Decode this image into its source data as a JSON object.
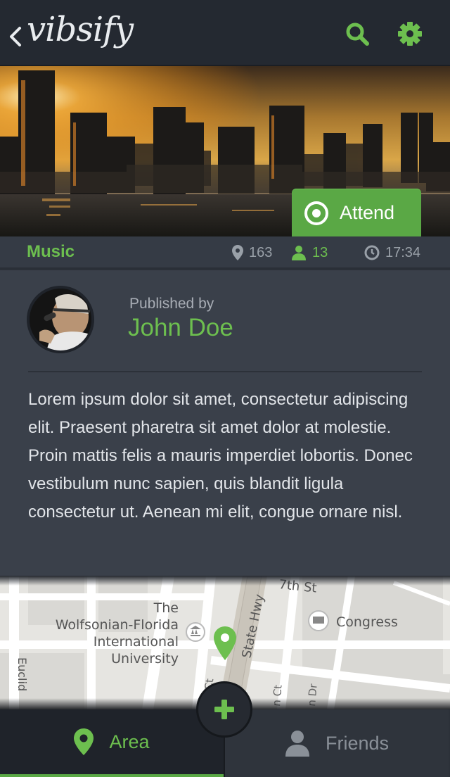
{
  "header": {
    "app_name": "vibsify",
    "icons": {
      "back": "chevron-left-icon",
      "search": "search-icon",
      "settings": "gear-icon"
    }
  },
  "event": {
    "attend_label": "Attend",
    "category": "Music",
    "distance": "163",
    "attendees": "13",
    "time": "17:34"
  },
  "publisher": {
    "label": "Published by",
    "name": "John Doe"
  },
  "description": "Lorem ipsum dolor sit amet, consectetur adipiscing elit. Praesent pharetra sit amet dolor at molestie. Proin mattis felis a mauris imperdiet lobortis. Donec vestibulum nunc sapien, quis blandit ligula consectetur ut. Aenean mi elit, congue ornare nisl.",
  "map": {
    "labels": {
      "museum_l1": "The",
      "museum_l2": "Wolfsonian-Florida",
      "museum_l3": "International",
      "museum_l4": "University",
      "hotel": "Congress",
      "street_state_hwy": "State Hwy",
      "street_7th": "7th St",
      "street_euclid": "Euclid",
      "street_ct1": "ns Ct",
      "street_ct2": "n Ct",
      "street_dr": "n Dr"
    }
  },
  "nav": {
    "area_label": "Area",
    "friends_label": "Friends",
    "add_label": "+"
  },
  "colors": {
    "accent": "#6dbf4f",
    "header_bg": "#242931",
    "card_bg": "#3a404a"
  }
}
